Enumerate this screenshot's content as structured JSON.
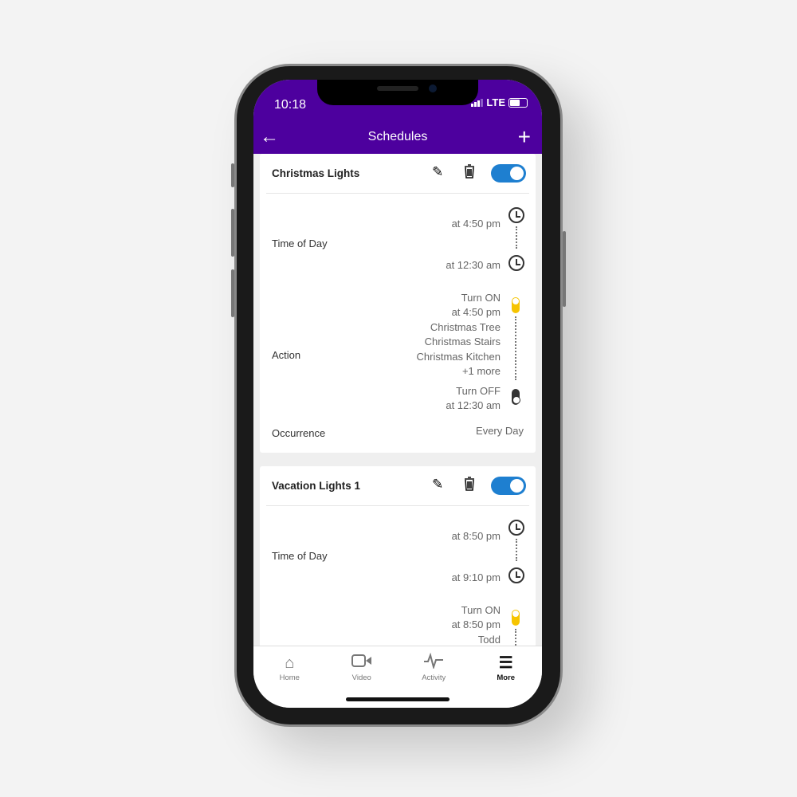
{
  "status": {
    "time": "10:18",
    "network": "LTE"
  },
  "header": {
    "title": "Schedules"
  },
  "schedules": [
    {
      "name": "Christmas Lights",
      "enabled": true,
      "time_label": "Time of Day",
      "start": "at 4:50 pm",
      "end": "at 12:30 am",
      "action_label": "Action",
      "on_label": "Turn ON",
      "on_time": "at 4:50 pm",
      "devices": [
        "Christmas Tree",
        "Christmas Stairs",
        "Christmas Kitchen"
      ],
      "more": "+1 more",
      "off_label": "Turn OFF",
      "off_time": "at 12:30 am",
      "occurrence_label": "Occurrence",
      "occurrence": "Every Day"
    },
    {
      "name": "Vacation Lights 1",
      "enabled": true,
      "time_label": "Time of Day",
      "start": "at 8:50 pm",
      "end": "at 9:10 pm",
      "on_label": "Turn ON",
      "on_time": "at 8:50 pm",
      "devices": [
        "Todd"
      ]
    }
  ],
  "tabs": [
    {
      "label": "Home",
      "icon": "home-icon"
    },
    {
      "label": "Video",
      "icon": "video-icon"
    },
    {
      "label": "Activity",
      "icon": "activity-icon"
    },
    {
      "label": "More",
      "icon": "menu-icon",
      "active": true
    }
  ],
  "colors": {
    "header": "#4d009e",
    "toggle": "#1e7fd0",
    "on": "#f6c400"
  }
}
